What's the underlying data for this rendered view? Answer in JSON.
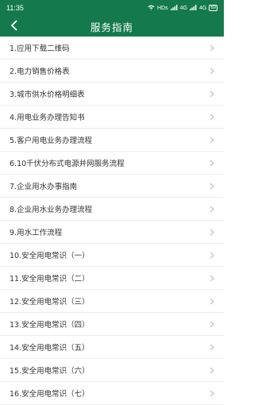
{
  "status_bar": {
    "time": "11:35",
    "network_label": "HDs",
    "signal1": "4G",
    "signal2": "4G",
    "battery": "69"
  },
  "header": {
    "title": "服务指南",
    "background": "#157a4b"
  },
  "items": [
    {
      "label": "1.应用下载二维码"
    },
    {
      "label": "2.电力销售价格表"
    },
    {
      "label": "3.城市供水价格明细表"
    },
    {
      "label": "4.用电业务办理告知书"
    },
    {
      "label": "5.客户用电业务办理流程"
    },
    {
      "label": "6.10千伏分布式电源并网服务流程"
    },
    {
      "label": "7.企业用水办事指南"
    },
    {
      "label": "8.企业用水业务办理流程"
    },
    {
      "label": "9.用水工作流程"
    },
    {
      "label": "10.安全用电常识（一）"
    },
    {
      "label": "11.安全用电常识（二）"
    },
    {
      "label": "12.安全用电常识（三）"
    },
    {
      "label": "13.安全用电常识（四）"
    },
    {
      "label": "14.安全用电常识（五）"
    },
    {
      "label": "15.安全用电常识（六）"
    },
    {
      "label": "16.安全用电常识（七）"
    }
  ],
  "icons": {
    "back": "back-arrow-icon",
    "chevron": "chevron-right-icon"
  }
}
